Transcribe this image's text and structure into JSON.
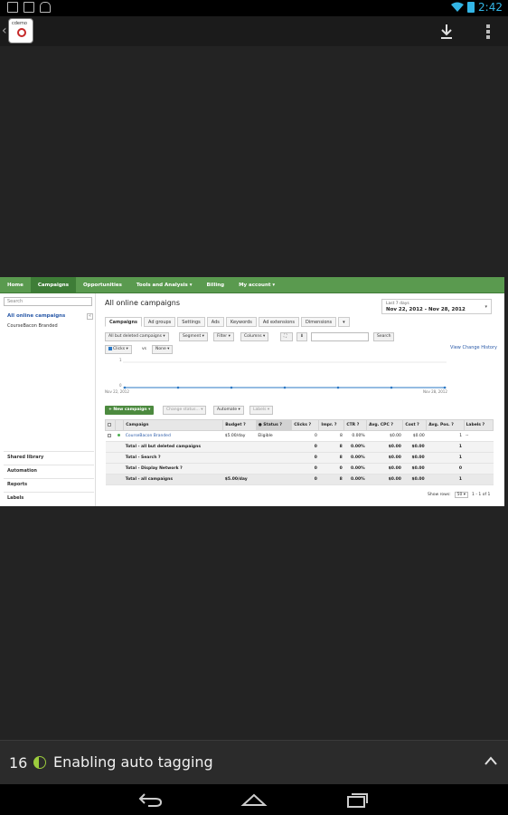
{
  "status_bar": {
    "time": "2:42"
  },
  "app_bar": {
    "app_icon_label": "cdemo"
  },
  "adwords": {
    "nav": [
      "Home",
      "Campaigns",
      "Opportunities",
      "Tools and Analysis ▾",
      "Billing",
      "My account ▾"
    ],
    "sidebar": {
      "search_placeholder": "Search",
      "all_campaigns": "All online campaigns",
      "campaign": "CourseBacon Branded",
      "collapse": "«",
      "links": [
        "Shared library",
        "Automation",
        "Reports",
        "Labels"
      ]
    },
    "main": {
      "title": "All online campaigns",
      "date_label": "Last 7 days",
      "date_range": "Nov 22, 2012 - Nov 28, 2012",
      "tabs": [
        "Campaigns",
        "Ad groups",
        "Settings",
        "Ads",
        "Keywords",
        "Ad extensions",
        "Dimensions",
        "▾"
      ],
      "toolbar": {
        "filter_scope": "All but deleted campaigns ▾",
        "segment": "Segment ▾",
        "filter": "Filter ▾",
        "columns": "Columns ▾",
        "search": "Search"
      },
      "chart_ctrls": {
        "metric1": "Clicks ▾",
        "vs": "vs",
        "metric2": "None ▾",
        "view_history": "View Change History"
      },
      "chart": {
        "y_top": "1",
        "y_bottom": "0",
        "x_start": "Nov 22, 2012",
        "x_end": "Nov 28, 2012"
      },
      "actions": {
        "new_campaign": "+ New campaign ▾",
        "change_status": "Change status... ▾",
        "automate": "Automate ▾",
        "labels": "Labels ▾"
      },
      "table": {
        "headers": [
          "",
          "",
          "Campaign",
          "Budget ?",
          "● Status ?",
          "Clicks ?",
          "Impr. ?",
          "CTR ?",
          "Avg. CPC ?",
          "Cost ?",
          "Avg. Pos. ?",
          "Labels ?"
        ],
        "rows": [
          {
            "campaign": "CourseBacon Branded",
            "budget": "$5.00/day",
            "status": "Eligible",
            "clicks": "0",
            "impr": "8",
            "ctr": "0.00%",
            "cpc": "$0.00",
            "cost": "$0.00",
            "pos": "1",
            "labels": "--"
          }
        ],
        "totals": [
          {
            "label": "Total - all but deleted campaigns",
            "budget": "",
            "clicks": "0",
            "impr": "8",
            "ctr": "0.00%",
            "cpc": "$0.00",
            "cost": "$0.00",
            "pos": "1"
          },
          {
            "label": "Total - Search ?",
            "budget": "",
            "clicks": "0",
            "impr": "8",
            "ctr": "0.00%",
            "cpc": "$0.00",
            "cost": "$0.00",
            "pos": "1"
          },
          {
            "label": "Total - Display Network ?",
            "budget": "",
            "clicks": "0",
            "impr": "0",
            "ctr": "0.00%",
            "cpc": "$0.00",
            "cost": "$0.00",
            "pos": "0"
          },
          {
            "label": "Total - all campaigns",
            "budget": "$5.00/day",
            "clicks": "0",
            "impr": "8",
            "ctr": "0.00%",
            "cpc": "$0.00",
            "cost": "$0.00",
            "pos": "1"
          }
        ]
      },
      "pager": {
        "show_rows": "Show rows:",
        "rows_value": "50 ▾",
        "range": "1 - 1 of 1"
      }
    }
  },
  "chapter_bar": {
    "number": "16",
    "title": "Enabling auto tagging"
  }
}
